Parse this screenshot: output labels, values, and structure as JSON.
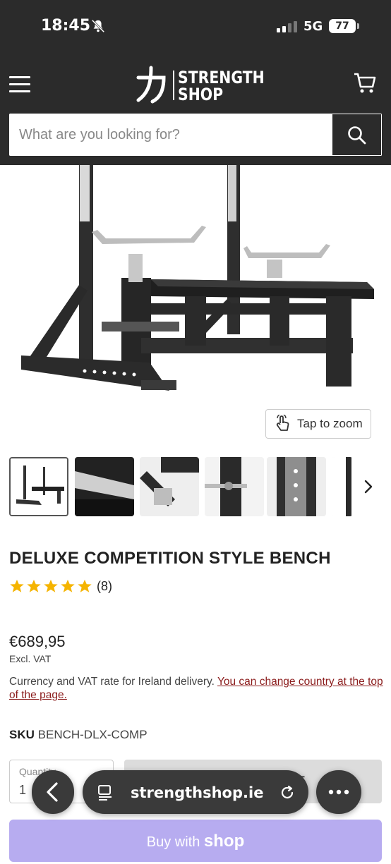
{
  "status_bar": {
    "time": "18:45",
    "network": "5G",
    "battery": "77"
  },
  "header": {
    "logo_line1": "STRENGTH",
    "logo_line2": "SHOP",
    "logo_mark": "力",
    "search_placeholder": "What are you looking for?"
  },
  "hero": {
    "zoom_label": "Tap to zoom"
  },
  "product": {
    "title": "DELUXE COMPETITION STYLE BENCH",
    "rating": 5,
    "review_count": "(8)",
    "price": "€689,95",
    "vat_note": "Excl. VAT",
    "currency_note": "Currency and VAT rate for Ireland delivery. ",
    "currency_link": "You can change country at the top of the page.",
    "sku_label": "SKU",
    "sku_value": "BENCH-DLX-COMP",
    "quantity_label": "Quantity",
    "quantity_value": "1",
    "add_to_cart": "ADD TO CART",
    "buy_with": "Buy with",
    "buy_brand": "shop"
  },
  "browser": {
    "url": "strengthshop.ie"
  },
  "icons": [
    "bell-off-icon",
    "signal-icon",
    "menu-icon",
    "cart-icon",
    "search-icon",
    "zoom-hand-icon",
    "chevron-right-icon",
    "star-icon",
    "back-icon",
    "reader-icon",
    "reload-icon",
    "more-icon"
  ],
  "colors": {
    "header_bg": "#2b2b2b",
    "link": "#8b1c1c",
    "star": "#f5b400",
    "shop_button": "#b7acf0"
  }
}
